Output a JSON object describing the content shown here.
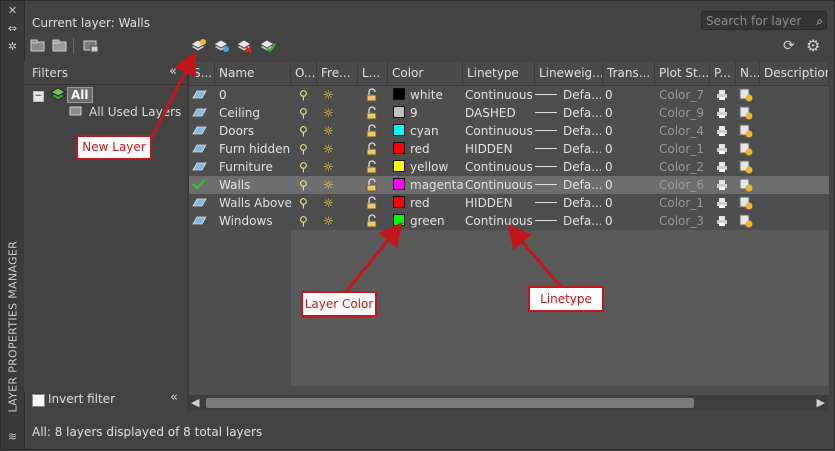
{
  "header": {
    "current_layer": "Current layer: Walls",
    "search_placeholder": "Search for layer"
  },
  "sidebar": {
    "vertical_title": "LAYER PROPERTIES MANAGER"
  },
  "filters": {
    "title": "Filters",
    "tree": {
      "root": "All",
      "child": "All Used Layers"
    },
    "invert_filter_label": "Invert filter"
  },
  "columns": [
    "S...",
    "Name",
    "O...",
    "Fre...",
    "L...",
    "Color",
    "Linetype",
    "Lineweig...",
    "Trans...",
    "Plot St...",
    "P...",
    "N...",
    "Description"
  ],
  "layers": [
    {
      "name": "0",
      "color_name": "white",
      "color_hex": "#000000",
      "linetype": "Continuous",
      "lineweight": "Defa...",
      "transparency": "0",
      "plot_style": "Color_7",
      "current": false
    },
    {
      "name": "Ceiling",
      "color_name": "9",
      "color_hex": "#c0c0c0",
      "linetype": "DASHED",
      "lineweight": "Defa...",
      "transparency": "0",
      "plot_style": "Color_9",
      "current": false
    },
    {
      "name": "Doors",
      "color_name": "cyan",
      "color_hex": "#00ffff",
      "linetype": "Continuous",
      "lineweight": "Defa...",
      "transparency": "0",
      "plot_style": "Color_4",
      "current": false
    },
    {
      "name": "Furn hidden",
      "color_name": "red",
      "color_hex": "#ff0000",
      "linetype": "HIDDEN",
      "lineweight": "Defa...",
      "transparency": "0",
      "plot_style": "Color_1",
      "current": false
    },
    {
      "name": "Furniture",
      "color_name": "yellow",
      "color_hex": "#ffff00",
      "linetype": "Continuous",
      "lineweight": "Defa...",
      "transparency": "0",
      "plot_style": "Color_2",
      "current": false
    },
    {
      "name": "Walls",
      "color_name": "magenta",
      "color_hex": "#ff00ff",
      "linetype": "Continuous",
      "lineweight": "Defa...",
      "transparency": "0",
      "plot_style": "Color_6",
      "current": true
    },
    {
      "name": "Walls Above",
      "color_name": "red",
      "color_hex": "#ff0000",
      "linetype": "HIDDEN",
      "lineweight": "Defa...",
      "transparency": "0",
      "plot_style": "Color_1",
      "current": false
    },
    {
      "name": "Windows",
      "color_name": "green",
      "color_hex": "#00ff00",
      "linetype": "Continuous",
      "lineweight": "Defa...",
      "transparency": "0",
      "plot_style": "Color_3",
      "current": false
    }
  ],
  "callouts": {
    "new_layer": "New Layer",
    "layer_color": "Layer Color",
    "linetype": "Linetype"
  },
  "status": {
    "text": "All: 8 layers displayed of 8 total layers"
  },
  "colors": {
    "callout_red": "#c3161c",
    "panel_bg": "#434343",
    "selected_row": "#6d6d6d"
  }
}
